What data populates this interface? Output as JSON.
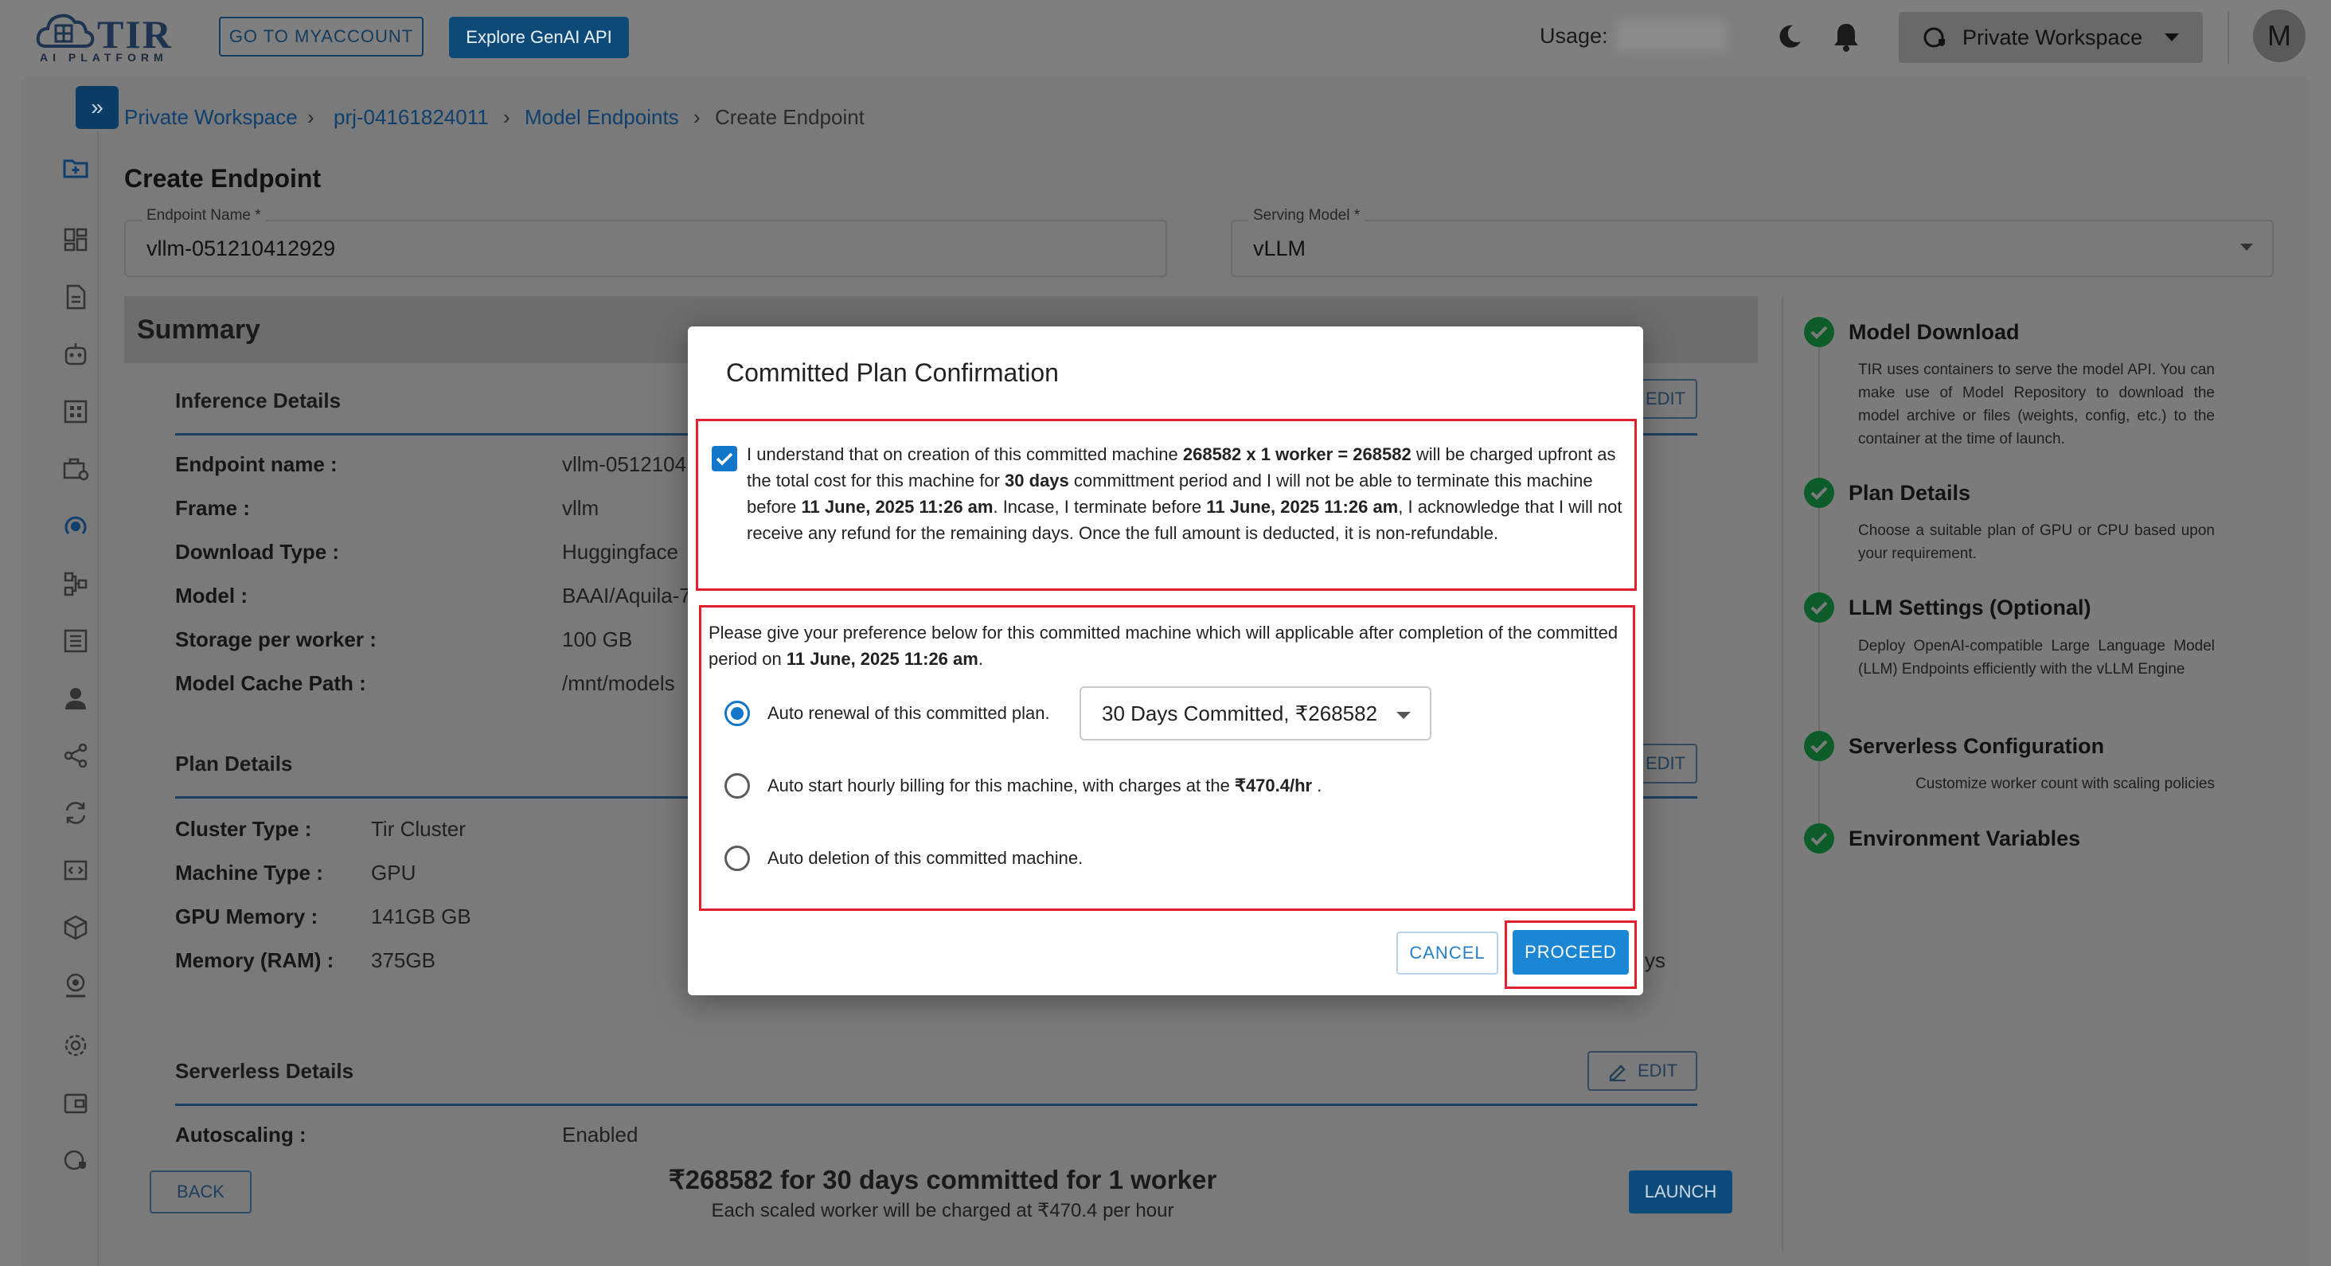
{
  "topbar": {
    "logo_text": "TIR",
    "logo_sub": "AI PLATFORM",
    "myaccount_label": "GO TO MYACCOUNT",
    "genai_label": "Explore GenAI API",
    "usage_label": "Usage:",
    "workspace_label": "Private Workspace",
    "avatar_initial": "M"
  },
  "breadcrumb": {
    "items": [
      "Private Workspace",
      "prj-04161824011",
      "Model Endpoints"
    ],
    "current": "Create Endpoint",
    "separator": "›"
  },
  "page": {
    "title": "Create Endpoint",
    "endpoint_name_label": "Endpoint Name *",
    "endpoint_name_value": "vllm-051210412929",
    "serving_model_label": "Serving Model *",
    "serving_model_value": "vLLM"
  },
  "summary": {
    "title": "Summary",
    "inference": {
      "title": "Inference Details",
      "edit": "EDIT",
      "rows": [
        {
          "k": "Endpoint name :",
          "v": "vllm-0512104"
        },
        {
          "k": "Frame :",
          "v": "vllm"
        },
        {
          "k": "Download Type :",
          "v": "Huggingface"
        },
        {
          "k": "Model :",
          "v": "BAAI/Aquila-7"
        },
        {
          "k": "Storage per worker :",
          "v": "100 GB"
        },
        {
          "k": "Model Cache Path :",
          "v": "/mnt/models"
        }
      ]
    },
    "plan": {
      "title": "Plan Details",
      "edit": "EDIT",
      "rows": [
        {
          "k": "Cluster Type :",
          "v": "Tir Cluster"
        },
        {
          "k": "Machine Type :",
          "v": "GPU"
        },
        {
          "k": "GPU Memory :",
          "v": "141GB GB"
        },
        {
          "k": "Memory (RAM) :",
          "v": "375GB"
        }
      ],
      "clipped_text": "ys"
    },
    "serverless": {
      "title": "Serverless Details",
      "edit": "EDIT",
      "rows": [
        {
          "k": "Autoscaling :",
          "v": "Enabled"
        }
      ]
    }
  },
  "footer": {
    "back": "BACK",
    "launch": "LAUNCH",
    "price": "₹268582 for 30 days committed for 1 worker",
    "note": "Each scaled worker will be charged at ₹470.4 per hour"
  },
  "steps": [
    {
      "title": "Model Download",
      "desc": "TIR uses containers to serve the model API. You can make use of Model Repository to download the model archive or files (weights, config, etc.) to the container at the time of launch."
    },
    {
      "title": "Plan Details",
      "desc": "Choose a suitable plan of GPU or CPU based upon your requirement."
    },
    {
      "title": "LLM Settings (Optional)",
      "desc": "Deploy OpenAI-compatible Large Language Model (LLM) Endpoints efficiently with the vLLM Engine"
    },
    {
      "title": "Serverless Configuration",
      "desc": "Customize worker count with scaling policies"
    },
    {
      "title": "Environment Variables",
      "desc": ""
    }
  ],
  "modal": {
    "title": "Committed Plan Confirmation",
    "ack": {
      "t1": "I understand that on creation of this committed machine ",
      "b1": "268582 x 1 worker = 268582",
      "t2": " will be charged upfront as the total cost for this machine for ",
      "b2": "30 days",
      "t3": " committment period and I will not be able to terminate this machine before ",
      "b3": "11 June, 2025 11:26 am",
      "t4": ". Incase, I terminate before ",
      "b4": "11 June, 2025 11:26 am",
      "t5": ", I acknowledge that I will not receive any refund for the remaining days. Once the full amount is deducted, it is non-refundable."
    },
    "pref": {
      "t1": "Please give your preference below for this committed machine which will applicable after completion of the committed period on ",
      "b1": "11 June, 2025 11:26 am",
      "t2": "."
    },
    "options": {
      "renew": "Auto renewal of this committed plan.",
      "renew_select": "30 Days Committed, ₹268582",
      "hourly_t1": "Auto start hourly billing for this machine, with charges at the ",
      "hourly_b1": "₹470.4/hr",
      "hourly_t2": " .",
      "delete": "Auto deletion of this committed machine."
    },
    "cancel": "CANCEL",
    "proceed": "PROCEED"
  }
}
